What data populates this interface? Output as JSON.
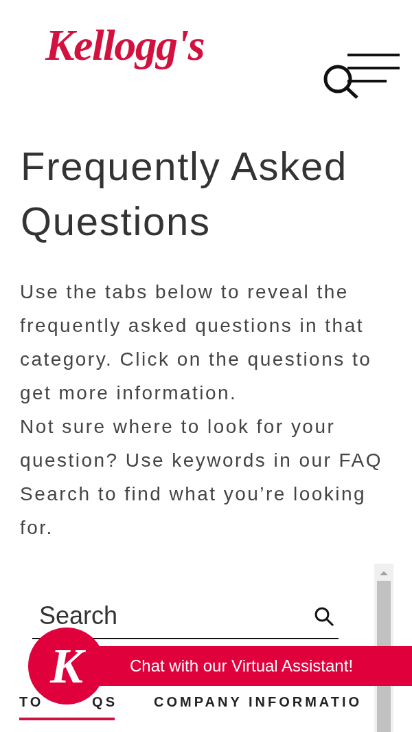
{
  "header": {
    "logo": "Kellogg's"
  },
  "title": "Frequently Asked Questions",
  "intro": [
    "Use the tabs below to reveal the frequently asked questions in that category. Click on the questions to get more information.",
    "Not sure where to look for your question? Use keywords in our FAQ Search to find what you’re looking for."
  ],
  "search": {
    "placeholder": "Search"
  },
  "tabs": [
    {
      "label_parts": [
        "TO",
        "QS"
      ],
      "selected": true
    },
    {
      "label_parts": [
        "COMPANY INFORMATIO"
      ],
      "selected": false
    }
  ],
  "chat": {
    "logo_letter": "K",
    "label": "Chat with our Virtual Assistant!"
  }
}
